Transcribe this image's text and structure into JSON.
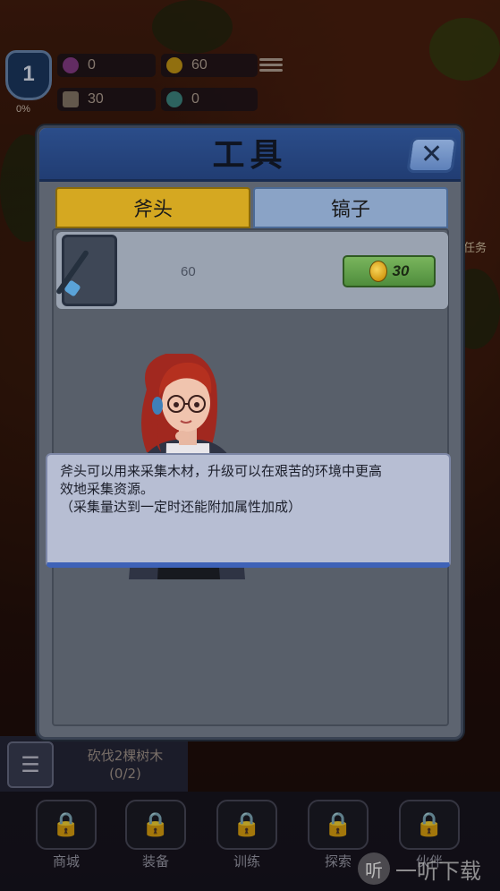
{
  "hud": {
    "level": "1",
    "level_progress": "0%",
    "gems": "0",
    "coins": "60",
    "wood": "30",
    "ore": "0"
  },
  "side_label": "任务",
  "quest": {
    "text": "砍伐2棵树木",
    "progress": "(0/2)"
  },
  "bottom_nav": [
    {
      "label": "商城",
      "icon": "lock-icon"
    },
    {
      "label": "装备",
      "icon": "lock-icon"
    },
    {
      "label": "训练",
      "icon": "lock-icon"
    },
    {
      "label": "探索",
      "icon": "lock-icon"
    },
    {
      "label": "伙伴",
      "icon": "lock-icon"
    }
  ],
  "watermark": "一听下载",
  "modal": {
    "title": "工具",
    "close_icon": "close-icon",
    "tabs": [
      {
        "label": "斧头",
        "active": true
      },
      {
        "label": "镐子",
        "active": false
      }
    ],
    "item": {
      "icon": "axe-icon",
      "progress_value": "60",
      "upgrade_cost": "30"
    },
    "description": [
      "斧头可以用来采集木材，升级可以在艰苦的环境中更高",
      "效地采集资源。",
      "（采集量达到一定时还能附加属性加成）"
    ]
  },
  "colors": {
    "header_blue": "#2b4d8a",
    "tab_active": "#d5a821",
    "tab_inactive": "#8aa3c6",
    "upgrade_green": "#4f8d3c",
    "desc_border": "#3e62b7"
  }
}
